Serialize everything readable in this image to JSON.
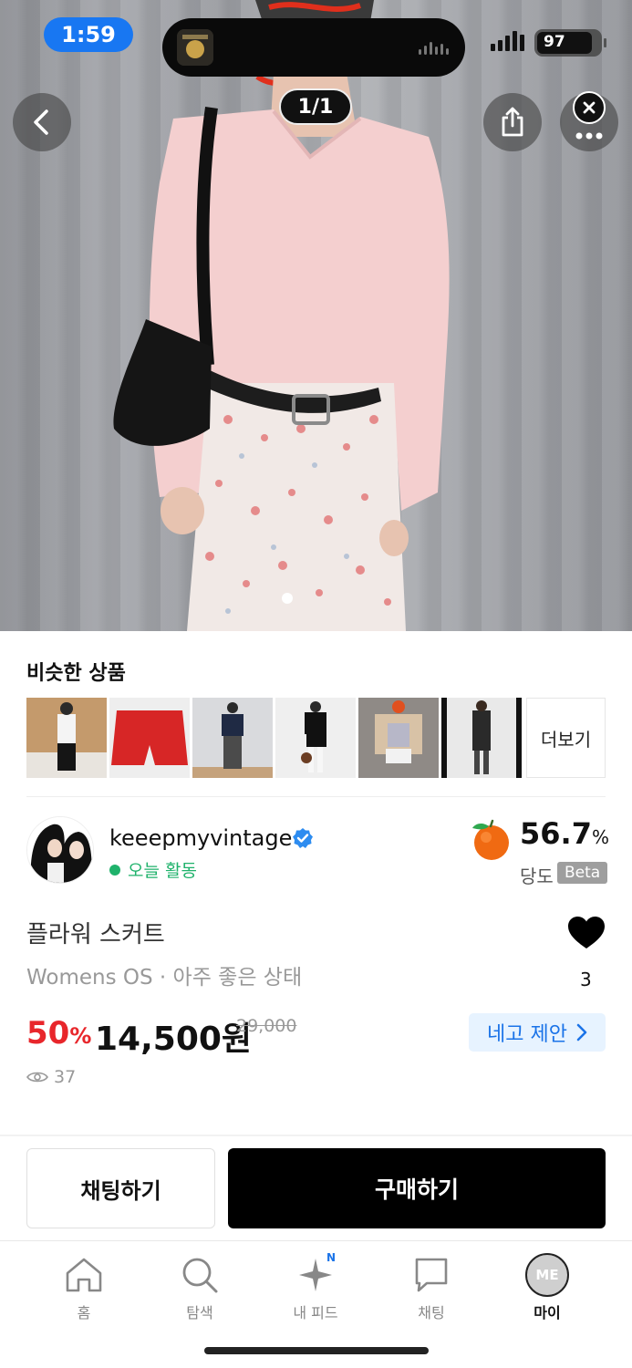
{
  "status_bar": {
    "time": "1:59",
    "battery": "97",
    "battery_level": 0.97
  },
  "image_viewer": {
    "counter": "1/1",
    "page_index": 1,
    "page_total": 1
  },
  "similar": {
    "title": "비슷한 상품",
    "more_label": "더보기",
    "thumbnails": [
      {
        "name": "similar-item-1",
        "bg": "#c9a27a"
      },
      {
        "name": "similar-item-2",
        "bg": "#d92b2b"
      },
      {
        "name": "similar-item-3",
        "bg": "#d8d9dc"
      },
      {
        "name": "similar-item-4",
        "bg": "#ececec"
      },
      {
        "name": "similar-item-5",
        "bg": "#8e8a86"
      },
      {
        "name": "similar-item-6",
        "bg": "#e6e6e6"
      }
    ]
  },
  "seller": {
    "name": "keeepmyvintage",
    "activity": "오늘 활동",
    "rating_value": "56.7",
    "rating_unit": "%",
    "rating_label": "당도",
    "beta_label": "Beta"
  },
  "product": {
    "name": "플라워 스커트",
    "meta": "Womens OS · 아주 좋은 상태",
    "like_count": "3",
    "discount_value": "50",
    "discount_unit": "%",
    "price": "14,500원",
    "original_price": "29,000",
    "offer_label": "네고 제안",
    "views": "37"
  },
  "actions": {
    "chat_label": "채팅하기",
    "buy_label": "구매하기"
  },
  "tabbar": {
    "home": "홈",
    "search": "탐색",
    "feed": "내 피드",
    "feed_badge": "N",
    "chat": "채팅",
    "my": "마이",
    "my_avatar": "ME"
  },
  "colors": {
    "accent_blue": "#1a73e8",
    "discount_red": "#e8262b",
    "activity_green": "#1fb26b",
    "buy_button": "#000000"
  },
  "icons": [
    "back-icon",
    "share-icon",
    "more-icon",
    "close-icon",
    "verified-icon",
    "fruit-icon",
    "heart-icon",
    "eye-icon",
    "chevron-right-icon",
    "home-icon",
    "search-icon",
    "sparkle-icon",
    "chat-icon"
  ]
}
